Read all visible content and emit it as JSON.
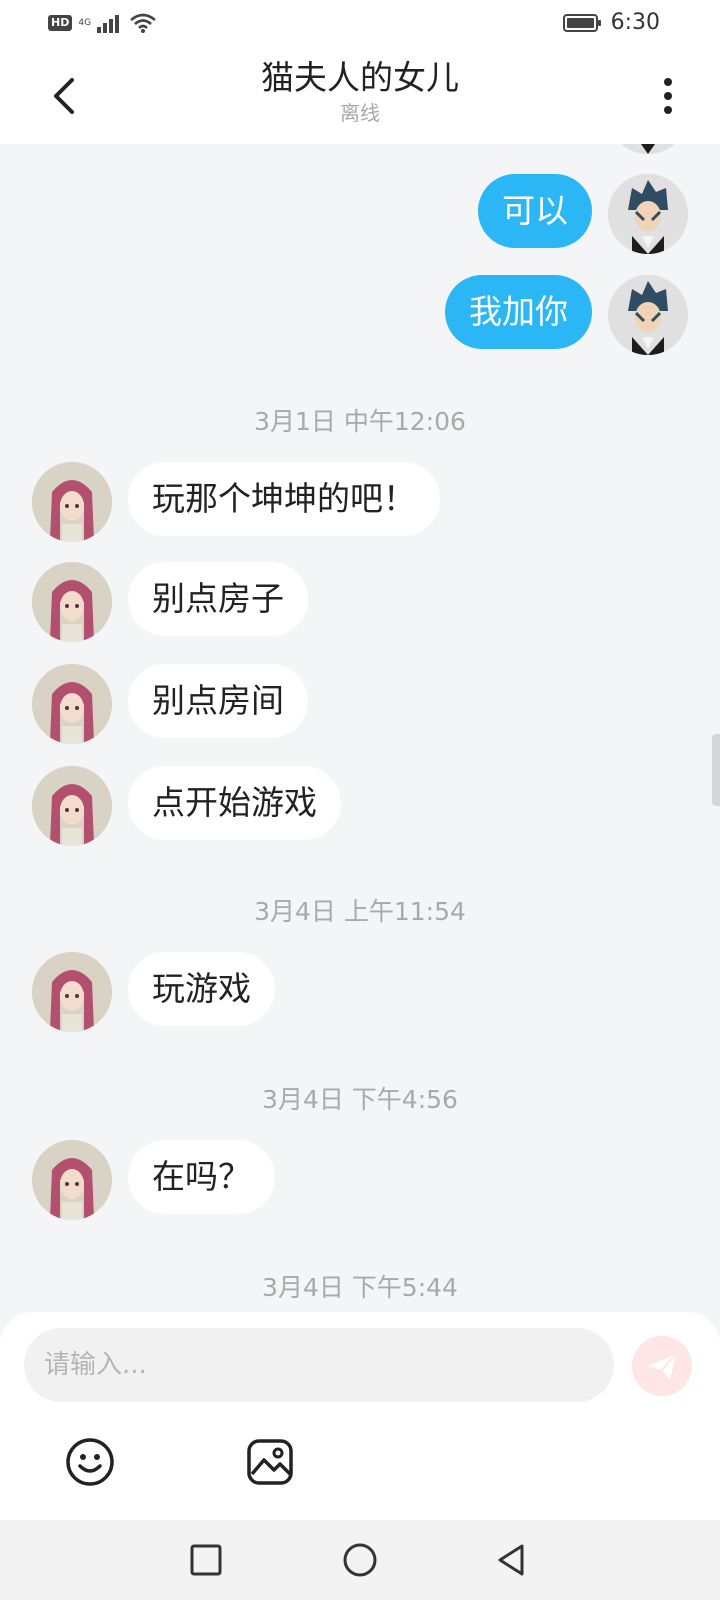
{
  "status_bar": {
    "hd": "HD",
    "network": "4G",
    "time": "6:30"
  },
  "header": {
    "title": "猫夫人的女儿",
    "subtitle": "离线"
  },
  "messages": [
    {
      "side": "me",
      "text": "可以"
    },
    {
      "side": "me",
      "text": "我加你"
    },
    {
      "timestamp": "3月1日 中午12:06"
    },
    {
      "side": "them",
      "text": "玩那个坤坤的吧！"
    },
    {
      "side": "them",
      "text": "别点房子"
    },
    {
      "side": "them",
      "text": "别点房间"
    },
    {
      "side": "them",
      "text": "点开始游戏"
    },
    {
      "timestamp": "3月4日 上午11:54"
    },
    {
      "side": "them",
      "text": "玩游戏"
    },
    {
      "timestamp": "3月4日 下午4:56"
    },
    {
      "side": "them",
      "text": "在吗？"
    },
    {
      "timestamp": "3月4日 下午5:44"
    }
  ],
  "composer": {
    "placeholder": "请输入...",
    "send_icon": "send-icon",
    "tools": [
      "emoji-icon",
      "image-icon"
    ]
  },
  "colors": {
    "my_bubble": "#2bb6f6",
    "their_bubble": "#ffffff",
    "background": "#f4f5f7",
    "send_button": "#fde6e3"
  }
}
